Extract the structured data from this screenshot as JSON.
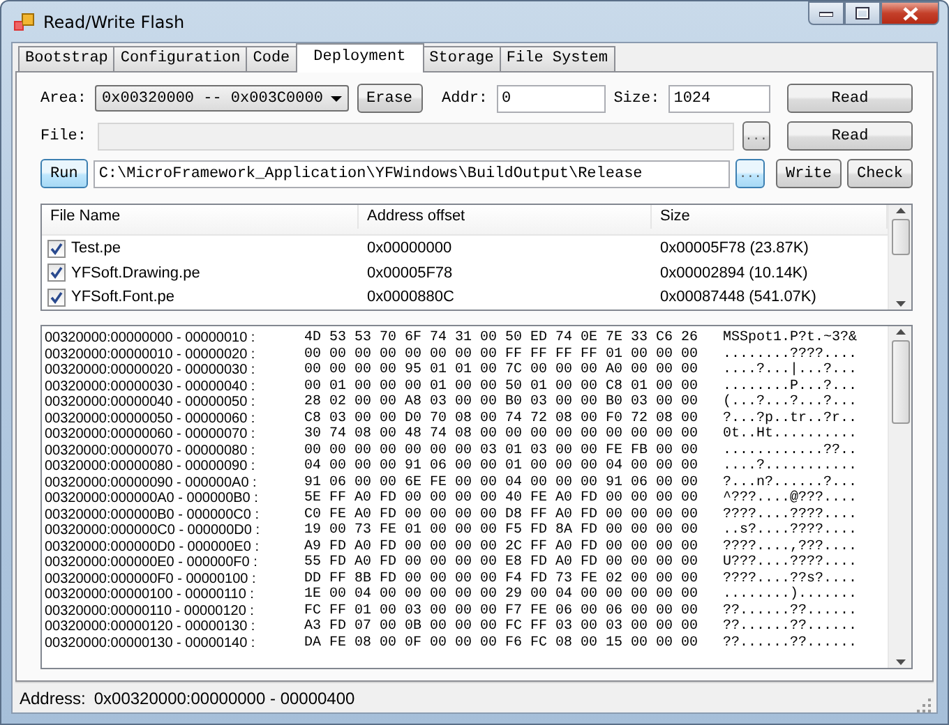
{
  "window": {
    "title": "Read/Write Flash"
  },
  "tabs": [
    {
      "label": "Bootstrap",
      "selected": false
    },
    {
      "label": "Configuration",
      "selected": false
    },
    {
      "label": "Code",
      "selected": false
    },
    {
      "label": "Deployment",
      "selected": true
    },
    {
      "label": "Storage",
      "selected": false
    },
    {
      "label": "File System",
      "selected": false
    }
  ],
  "area": {
    "label": "Area:",
    "value": "0x00320000 -- 0x003C0000"
  },
  "erase_button": {
    "label": "Erase",
    "highlighted": false
  },
  "addr": {
    "label": "Addr:",
    "value": "0"
  },
  "size": {
    "label": "Size:",
    "value": "1024"
  },
  "read_button_1": {
    "label": "Read",
    "highlighted": false
  },
  "file": {
    "label": "File:"
  },
  "file_browse": {
    "label": "...",
    "highlighted": false
  },
  "read_button_2": {
    "label": "Read",
    "highlighted": false
  },
  "run_button": {
    "label": "Run",
    "highlighted": true
  },
  "path": {
    "value": "C:\\MicroFramework_Application\\YFWindows\\BuildOutput\\Release"
  },
  "path_browse": {
    "label": "...",
    "highlighted": true
  },
  "write_button": {
    "label": "Write",
    "highlighted": false
  },
  "check_button": {
    "label": "Check",
    "highlighted": false
  },
  "file_list": {
    "columns": [
      "File Name",
      "Address offset",
      "Size"
    ],
    "rows": [
      {
        "checked": true,
        "name": "Test.pe",
        "offset": "0x00000000",
        "size": "0x00005F78 (23.87K)"
      },
      {
        "checked": true,
        "name": "YFSoft.Drawing.pe",
        "offset": "0x00005F78",
        "size": "0x00002894 (10.14K)"
      },
      {
        "checked": true,
        "name": "YFSoft.Font.pe",
        "offset": "0x0000880C",
        "size": "0x00087448 (541.07K)"
      }
    ]
  },
  "hex_dump": {
    "rows": [
      {
        "address": "00320000:00000000 - 00000010 :",
        "bytes": "4D 53 53 70 6F 74 31 00 50 ED 74 0E 7E 33 C6 26",
        "ascii": "MSSpot1.P?t.~3?&"
      },
      {
        "address": "00320000:00000010 - 00000020 :",
        "bytes": "00 00 00 00 00 00 00 00 FF FF FF FF 01 00 00 00",
        "ascii": "........????...."
      },
      {
        "address": "00320000:00000020 - 00000030 :",
        "bytes": "00 00 00 00 95 01 01 00 7C 00 00 00 A0 00 00 00",
        "ascii": "....?...|...?..."
      },
      {
        "address": "00320000:00000030 - 00000040 :",
        "bytes": "00 01 00 00 00 01 00 00 50 01 00 00 C8 01 00 00",
        "ascii": "........P...?..."
      },
      {
        "address": "00320000:00000040 - 00000050 :",
        "bytes": "28 02 00 00 A8 03 00 00 B0 03 00 00 B0 03 00 00",
        "ascii": "(...?...?...?..."
      },
      {
        "address": "00320000:00000050 - 00000060 :",
        "bytes": "C8 03 00 00 D0 70 08 00 74 72 08 00 F0 72 08 00",
        "ascii": "?...?p..tr..?r.."
      },
      {
        "address": "00320000:00000060 - 00000070 :",
        "bytes": "30 74 08 00 48 74 08 00 00 00 00 00 00 00 00 00",
        "ascii": "0t..Ht.........."
      },
      {
        "address": "00320000:00000070 - 00000080 :",
        "bytes": "00 00 00 00 00 00 00 03 01 03 00 00 FE FB 00 00",
        "ascii": "............??.."
      },
      {
        "address": "00320000:00000080 - 00000090 :",
        "bytes": "04 00 00 00 91 06 00 00 01 00 00 00 04 00 00 00",
        "ascii": "....?..........."
      },
      {
        "address": "00320000:00000090 - 000000A0 :",
        "bytes": "91 06 00 00 6E FE 00 00 04 00 00 00 91 06 00 00",
        "ascii": "?...n?......?..."
      },
      {
        "address": "00320000:000000A0 - 000000B0 :",
        "bytes": "5E FF A0 FD 00 00 00 00 40 FE A0 FD 00 00 00 00",
        "ascii": "^???....@???...."
      },
      {
        "address": "00320000:000000B0 - 000000C0 :",
        "bytes": "C0 FE A0 FD 00 00 00 00 D8 FF A0 FD 00 00 00 00",
        "ascii": "????....????...."
      },
      {
        "address": "00320000:000000C0 - 000000D0 :",
        "bytes": "19 00 73 FE 01 00 00 00 F5 FD 8A FD 00 00 00 00",
        "ascii": "..s?....????...."
      },
      {
        "address": "00320000:000000D0 - 000000E0 :",
        "bytes": "A9 FD A0 FD 00 00 00 00 2C FF A0 FD 00 00 00 00",
        "ascii": "????....,???...."
      },
      {
        "address": "00320000:000000E0 - 000000F0 :",
        "bytes": "55 FD A0 FD 00 00 00 00 E8 FD A0 FD 00 00 00 00",
        "ascii": "U???....????...."
      },
      {
        "address": "00320000:000000F0 - 00000100 :",
        "bytes": "DD FF 8B FD 00 00 00 00 F4 FD 73 FE 02 00 00 00",
        "ascii": "????....??s?...."
      },
      {
        "address": "00320000:00000100 - 00000110 :",
        "bytes": "1E 00 04 00 00 00 00 00 29 00 04 00 00 00 00 00",
        "ascii": "........)......."
      },
      {
        "address": "00320000:00000110 - 00000120 :",
        "bytes": "FC FF 01 00 03 00 00 00 F7 FE 06 00 06 00 00 00",
        "ascii": "??......??......"
      },
      {
        "address": "00320000:00000120 - 00000130 :",
        "bytes": "A3 FD 07 00 0B 00 00 00 FC FF 03 00 03 00 00 00",
        "ascii": "??......??......"
      },
      {
        "address": "00320000:00000130 - 00000140 :",
        "bytes": "DA FE 08 00 0F 00 00 00 F6 FC 08 00 15 00 00 00",
        "ascii": "??......??......"
      }
    ]
  },
  "status_bar": {
    "label": "Address:",
    "value": "0x00320000:00000000 - 00000400"
  }
}
